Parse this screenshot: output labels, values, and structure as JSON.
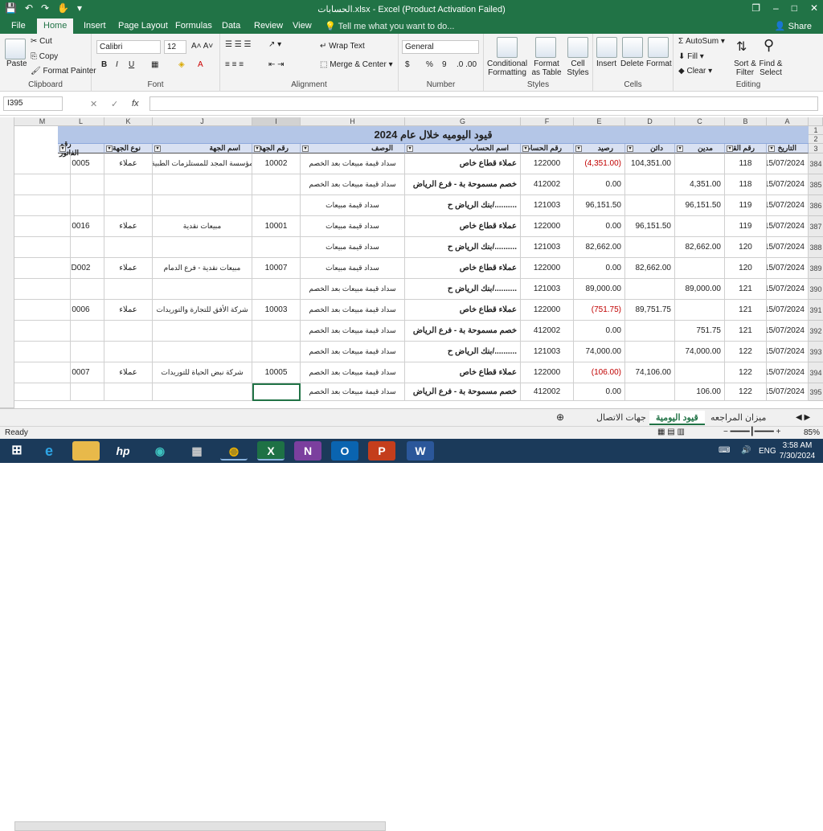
{
  "title": "الحسابات.xlsx - Excel (Product Activation Failed)",
  "window": {
    "restore": "❐",
    "minimize": "–",
    "maximize": "□",
    "close": "✕"
  },
  "qa": [
    "💾",
    "↶",
    "↷",
    "✋",
    "▾"
  ],
  "tabs": [
    "File",
    "Home",
    "Insert",
    "Page Layout",
    "Formulas",
    "Data",
    "Review",
    "View"
  ],
  "tell": "Tell me what you want to do...",
  "share": "Share",
  "clipboard": {
    "paste": "Paste",
    "cut": "Cut",
    "copy": "Copy",
    "painter": "Format Painter",
    "label": "Clipboard"
  },
  "font": {
    "name": "Calibri",
    "size": "12",
    "label": "Font",
    "b": "B",
    "i": "I",
    "u": "U"
  },
  "alignment": {
    "wrap": "Wrap Text",
    "merge": "Merge & Center",
    "label": "Alignment"
  },
  "number": {
    "format": "General",
    "label": "Number",
    "dollar": "$",
    "pct": "%",
    "comma": "9"
  },
  "styles": {
    "cond": "Conditional Formatting",
    "table": "Format as Table",
    "cell": "Cell Styles",
    "label": "Styles"
  },
  "cells": {
    "insert": "Insert",
    "delete": "Delete",
    "format": "Format",
    "label": "Cells"
  },
  "editing": {
    "autosum": "AutoSum",
    "fill": "Fill",
    "clear": "Clear",
    "sort": "Sort & Filter",
    "find": "Find & Select",
    "label": "Editing"
  },
  "namebox": "I395",
  "fx": "fx",
  "columns": [
    "M",
    "L",
    "K",
    "J",
    "I",
    "H",
    "G",
    "F",
    "E",
    "D",
    "C",
    "B",
    "A"
  ],
  "sheet_title": "قيود اليوميه خلال عام 2024",
  "headers": {
    "L": "رقم الفاتور",
    "K": "نوع الجهة",
    "J": "اسم الجهة",
    "I": "رقم الجهة",
    "H": "الوصف",
    "G": "اسم الحساب",
    "F": "رقم الحساب",
    "E": "رصيد",
    "D": "دائن",
    "C": "مدين",
    "B": "رقم القيد",
    "A": "التاريخ"
  },
  "row_numbers": [
    "1",
    "2",
    "3",
    "384",
    "385",
    "386",
    "387",
    "388",
    "389",
    "390",
    "391",
    "392",
    "393",
    "394",
    "395"
  ],
  "rows": [
    {
      "L": "0005",
      "K": "عملاء",
      "J": "مؤسسة المجد للمستلزمات الطبية",
      "I": "10002",
      "H": "سداد قيمة مبيعات بعد الخصم",
      "G": "عملاء قطاع خاص",
      "F": "122000",
      "E": "(4,351.00)",
      "Eneg": true,
      "D": "104,351.00",
      "C": "",
      "B": "118",
      "A": "15/07/2024"
    },
    {
      "L": "",
      "K": "",
      "J": "",
      "I": "",
      "H": "سداد قيمة مبيعات بعد الخصم",
      "G": "خصم مسموحة بة - فرع الرياض",
      "F": "412002",
      "E": "0.00",
      "Eneg": false,
      "D": "",
      "C": "4,351.00",
      "B": "118",
      "A": "15/07/2024"
    },
    {
      "L": "",
      "K": "",
      "J": "",
      "I": "",
      "H": "سداد قيمة مبيعات",
      "G": "بنك الرياض ح/..........",
      "F": "121003",
      "E": "96,151.50",
      "Eneg": false,
      "D": "",
      "C": "96,151.50",
      "B": "119",
      "A": "15/07/2024"
    },
    {
      "L": "0016",
      "K": "عملاء",
      "J": "مبيعات نقدية",
      "I": "10001",
      "H": "سداد قيمة مبيعات",
      "G": "عملاء قطاع خاص",
      "F": "122000",
      "E": "0.00",
      "Eneg": false,
      "D": "96,151.50",
      "C": "",
      "B": "119",
      "A": "15/07/2024"
    },
    {
      "L": "",
      "K": "",
      "J": "",
      "I": "",
      "H": "سداد قيمة مبيعات",
      "G": "بنك الرياض ح/..........",
      "F": "121003",
      "E": "82,662.00",
      "Eneg": false,
      "D": "",
      "C": "82,662.00",
      "B": "120",
      "A": "15/07/2024"
    },
    {
      "L": "D002",
      "K": "عملاء",
      "J": "مبيعات نقدية - فرع الدمام",
      "I": "10007",
      "H": "سداد قيمة مبيعات",
      "G": "عملاء قطاع خاص",
      "F": "122000",
      "E": "0.00",
      "Eneg": false,
      "D": "82,662.00",
      "C": "",
      "B": "120",
      "A": "15/07/2024"
    },
    {
      "L": "",
      "K": "",
      "J": "",
      "I": "",
      "H": "سداد قيمة مبيعات بعد الخصم",
      "G": "بنك الرياض ح/..........",
      "F": "121003",
      "E": "89,000.00",
      "Eneg": false,
      "D": "",
      "C": "89,000.00",
      "B": "121",
      "A": "15/07/2024"
    },
    {
      "L": "0006",
      "K": "عملاء",
      "J": "شركة الأفق للتجارة والتوريدات",
      "I": "10003",
      "H": "سداد قيمة مبيعات بعد الخصم",
      "G": "عملاء قطاع خاص",
      "F": "122000",
      "E": "(751.75)",
      "Eneg": true,
      "D": "89,751.75",
      "C": "",
      "B": "121",
      "A": "15/07/2024"
    },
    {
      "L": "",
      "K": "",
      "J": "",
      "I": "",
      "H": "سداد قيمة مبيعات بعد الخصم",
      "G": "خصم مسموحة بة - فرع الرياض",
      "F": "412002",
      "E": "0.00",
      "Eneg": false,
      "D": "",
      "C": "751.75",
      "B": "121",
      "A": "15/07/2024"
    },
    {
      "L": "",
      "K": "",
      "J": "",
      "I": "",
      "H": "سداد قيمة مبيعات بعد الخصم",
      "G": "بنك الرياض ح/..........",
      "F": "121003",
      "E": "74,000.00",
      "Eneg": false,
      "D": "",
      "C": "74,000.00",
      "B": "122",
      "A": "15/07/2024"
    },
    {
      "L": "0007",
      "K": "عملاء",
      "J": "شركة نبض الحياة للتوريدات",
      "I": "10005",
      "H": "سداد قيمة مبيعات بعد الخصم",
      "G": "عملاء قطاع خاص",
      "F": "122000",
      "E": "(106.00)",
      "Eneg": true,
      "D": "74,106.00",
      "C": "",
      "B": "122",
      "A": "15/07/2024"
    },
    {
      "L": "",
      "K": "",
      "J": "",
      "I": "",
      "H": "سداد قيمة مبيعات بعد الخصم",
      "G": "خصم مسموحة بة - فرع الرياض",
      "F": "412002",
      "E": "0.00",
      "Eneg": false,
      "D": "",
      "C": "106.00",
      "B": "122",
      "A": "15/07/2024"
    }
  ],
  "sheet_tabs": [
    "جهات الاتصال",
    "قيود اليومية",
    "ميزان المراجعه"
  ],
  "active_sheet": "قيود اليومية",
  "status": {
    "ready": "Ready",
    "zoom": "85%"
  },
  "taskbar": {
    "lang": "ENG",
    "time": "3:58 AM",
    "date": "7/30/2024"
  }
}
